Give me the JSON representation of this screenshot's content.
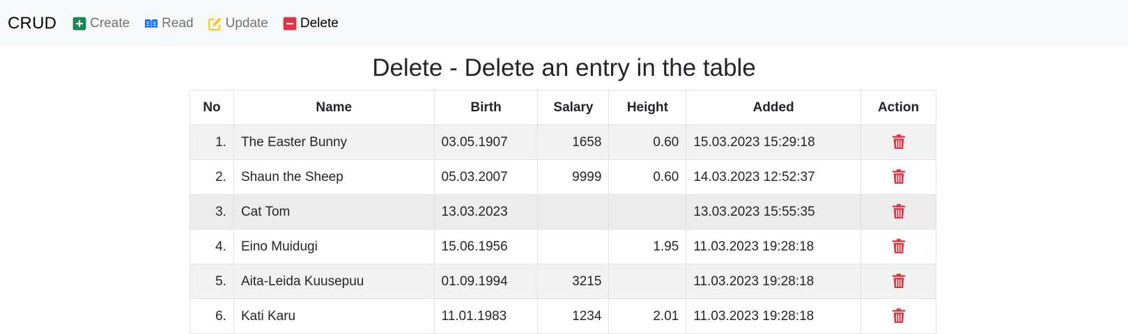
{
  "nav": {
    "brand": "CRUD",
    "items": [
      {
        "label": "Create",
        "icon": "plus-square-icon",
        "color": "#198754"
      },
      {
        "label": "Read",
        "icon": "book-icon",
        "color": "#0d6efd"
      },
      {
        "label": "Update",
        "icon": "pencil-square-icon",
        "color": "#ffc107"
      },
      {
        "label": "Delete",
        "icon": "minus-square-icon",
        "color": "#dc3545"
      }
    ],
    "active": "Delete"
  },
  "page": {
    "title": "Delete - Delete an entry in the table"
  },
  "table": {
    "headers": [
      "No",
      "Name",
      "Birth",
      "Salary",
      "Height",
      "Added",
      "Action"
    ],
    "rows": [
      {
        "no": "1.",
        "name": "The Easter Bunny",
        "birth": "03.05.1907",
        "salary": "1658",
        "height": "0.60",
        "added": "15.03.2023 15:29:18"
      },
      {
        "no": "2.",
        "name": "Shaun the Sheep",
        "birth": "05.03.2007",
        "salary": "9999",
        "height": "0.60",
        "added": "14.03.2023 12:52:37"
      },
      {
        "no": "3.",
        "name": "Cat Tom",
        "birth": "13.03.2023",
        "salary": "",
        "height": "",
        "added": "13.03.2023 15:55:35"
      },
      {
        "no": "4.",
        "name": "Eino Muidugi",
        "birth": "15.06.1956",
        "salary": "",
        "height": "1.95",
        "added": "11.03.2023 19:28:18"
      },
      {
        "no": "5.",
        "name": "Aita-Leida Kuusepuu",
        "birth": "01.09.1994",
        "salary": "3215",
        "height": "",
        "added": "11.03.2023 19:28:18"
      },
      {
        "no": "6.",
        "name": "Kati Karu",
        "birth": "11.01.1983",
        "salary": "1234",
        "height": "2.01",
        "added": "11.03.2023 19:28:18"
      }
    ],
    "action_icon": "trash-icon",
    "action_color": "#dc3545"
  }
}
